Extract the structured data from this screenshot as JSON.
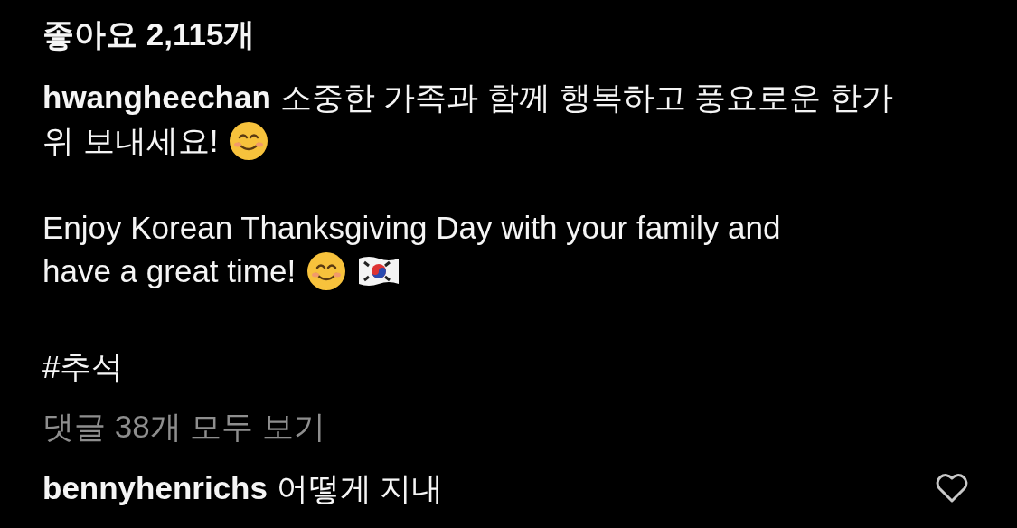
{
  "likes": "좋아요 2,115개",
  "caption_lines": [
    "**hwangheechan** 소중한 가족과 함께 행복하고 풍요로운 한가",
    "위 보내세요!"
  ],
  "translation_lines": [
    "Enjoy Korean Thanksgiving Day with your family and",
    "have a great time!"
  ],
  "hashtag": "#추석",
  "view_comments": "댓글 38개 모두 보기",
  "comments": [
    {
      "text": "**bennyhenrichs** 어떻게 지내",
      "liked": false
    }
  ]
}
